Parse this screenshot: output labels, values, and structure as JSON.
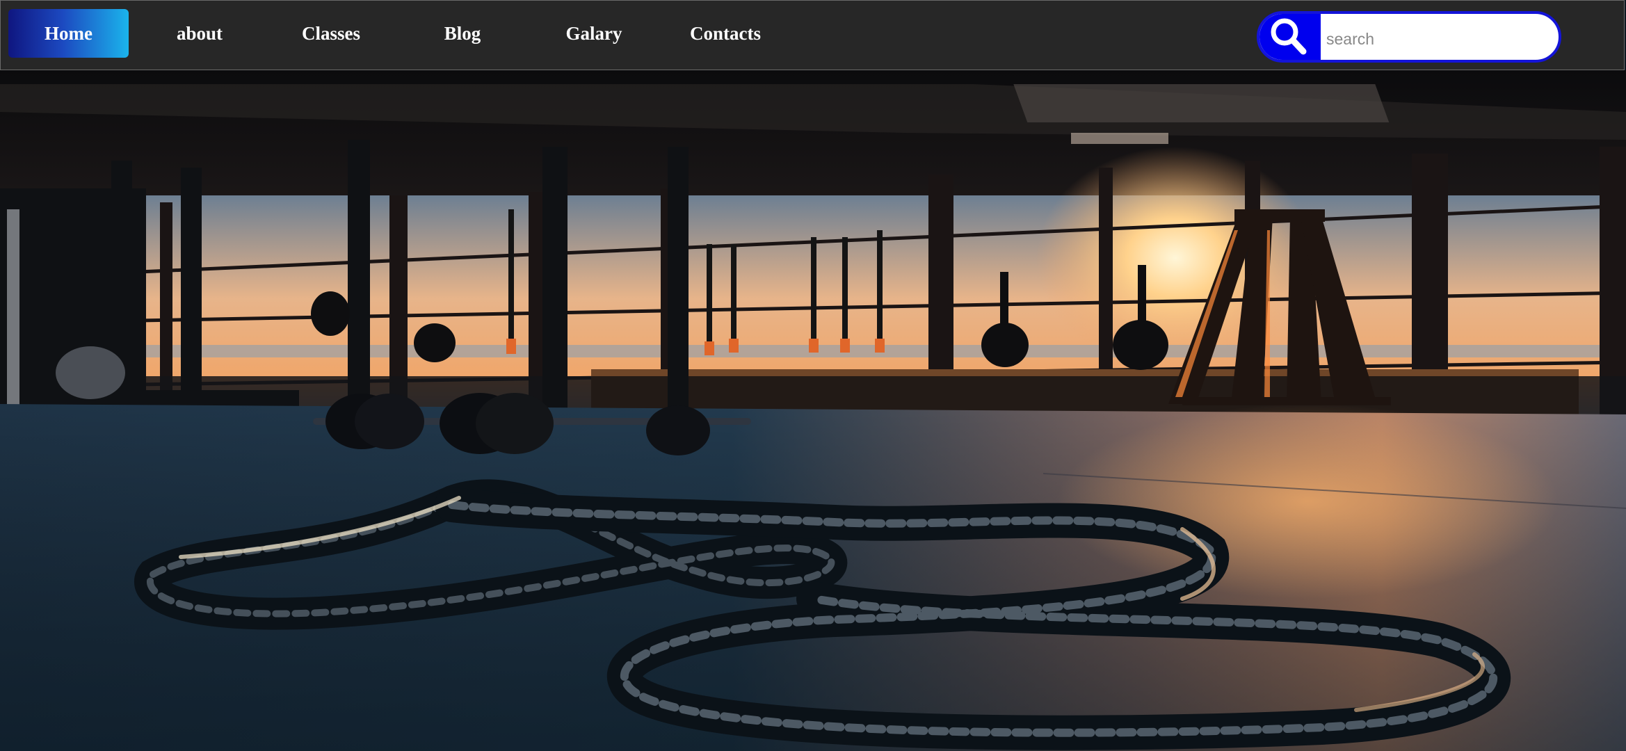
{
  "nav": {
    "items": [
      {
        "label": "Home",
        "active": true
      },
      {
        "label": "about",
        "active": false
      },
      {
        "label": "Classes",
        "active": false
      },
      {
        "label": "Blog",
        "active": false
      },
      {
        "label": "Galary",
        "active": false
      },
      {
        "label": "Contacts",
        "active": false
      }
    ]
  },
  "search": {
    "placeholder": "search",
    "value": "",
    "icon": "search-icon"
  },
  "hero": {
    "image": "gym-battle-ropes-sunset-photo"
  },
  "colors": {
    "nav_bg": "#272727",
    "active_gradient_start": "#0f1680",
    "active_gradient_end": "#1bb4ec",
    "search_accent": "#0000ee"
  }
}
